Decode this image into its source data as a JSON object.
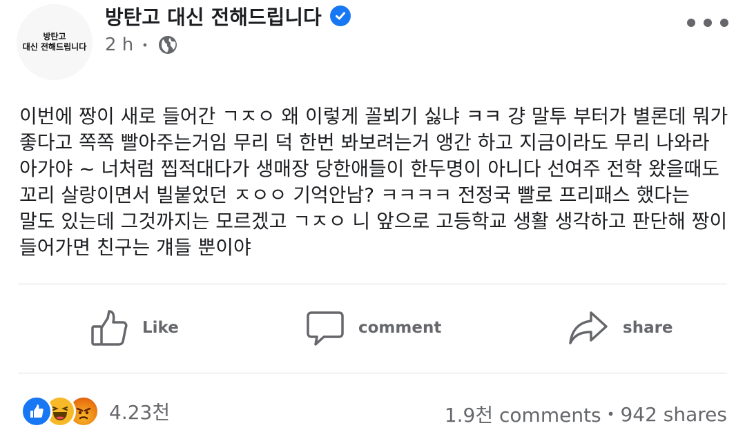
{
  "post": {
    "page_name": "방탄고 대신 전해드립니다",
    "avatar_lines": [
      "방탄고",
      "대신 전해드립니다"
    ],
    "time": "2 h",
    "meta_dot": "•",
    "body_text": "이번에 짱이 새로 들어간 ㄱㅈㅇ 왜 이렇게 꼴뵈기 싫냐 ㅋㅋ 걍 말투 부터가 별론데 뭐가 좋다고 쪽쪽 빨아주는거임 무리 덕 한번 봐보려는거 앵간 하고 지금이라도 무리 나와라 아가야 ~ 너처럼 찝적대다가 생매장 당한애들이 한두명이 아니다 선여주 전학 왔을때도 꼬리 살랑이면서 빌붙었던 ㅈㅇㅇ 기억안남? ㅋㅋㅋㅋ 전정국 빨로 프리패스 했다는 말도 있는데 그것까지는 모르겠고 ㄱㅈㅇ 니 앞으로 고등학교 생활 생각하고 판단해 짱이 들어가면 친구는 걔들 뿐이야"
  },
  "actions": {
    "like": "Like",
    "comment": "comment",
    "share": "share"
  },
  "footer": {
    "reaction_count": "4.23천",
    "comments": "1.9천 comments",
    "sep": "•",
    "shares": "942 shares"
  },
  "colors": {
    "verified": "#1877f2",
    "secondary_text": "#65676b",
    "divider": "#dadde1",
    "like_reaction": "#1877f2",
    "haha_reaction": "#f7b928",
    "angry_reaction": "#e9710f"
  },
  "icons": [
    "verified-badge-icon",
    "globe-icon",
    "more-options-icon",
    "like-icon",
    "comment-icon",
    "share-icon",
    "like-reaction-icon",
    "haha-reaction-icon",
    "angry-reaction-icon"
  ]
}
